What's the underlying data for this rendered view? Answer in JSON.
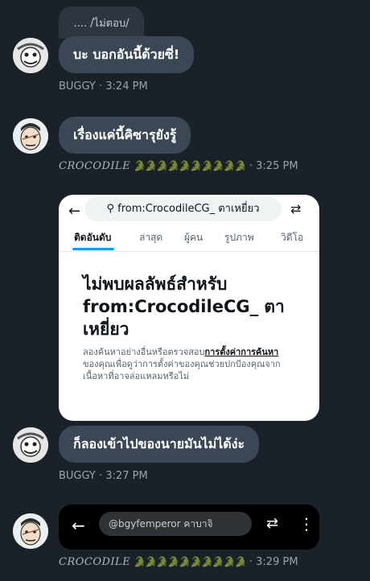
{
  "messages": [
    {
      "quoted": ".... /ไม่ตอบ/",
      "text": "บะ บอกอันนี้ด้วยซี่!",
      "sender": "BUGGY",
      "time": "3:24 PM"
    },
    {
      "text": "เรื่องแค่นี้คิซารุยังรู้",
      "sender": "CROCODILE",
      "emoji": "🐊🐊🐊🐊🐊🐊🐊🐊🐊🐊",
      "time": "3:25 PM"
    },
    {
      "text": "ก็ลองเข้าไปของนายมันไม่ได้ง่ะ",
      "sender": "BUGGY",
      "time": "3:27 PM"
    },
    {
      "sender": "CROCODILE",
      "emoji": "🐊🐊🐊🐊🐊🐊🐊🐊🐊🐊",
      "time": "3:29 PM"
    }
  ],
  "search_card": {
    "query": "from:CrocodileCG_ ตาเหยี่ยว",
    "tabs": [
      "ติดอันดับ",
      "ล่าสุด",
      "ผู้คน",
      "รูปภาพ",
      "วิดีโอ"
    ],
    "heading": "ไม่พบผลลัพธ์สำหรับ from:CrocodileCG_ ตาเหยี่ยว",
    "desc_part1": "ลองค้นหาอย่างอื่นหรือตรวจสอบ",
    "desc_link": "การตั้งค่าการค้นหา",
    "desc_part2": "ของคุณเพื่อดูว่าการตั้งค่าของคุณช่วยปกป้องคุณจากเนื้อหาที่อาจล่อแหลมหรือไม่"
  },
  "toolbar_card": {
    "search_value": "@bgyfemperor คาบาจิ"
  },
  "icons": {
    "back": "arrow-left-icon",
    "search": "magnifier-icon",
    "filter": "sliders-icon",
    "more": "vertical-dots-icon"
  }
}
